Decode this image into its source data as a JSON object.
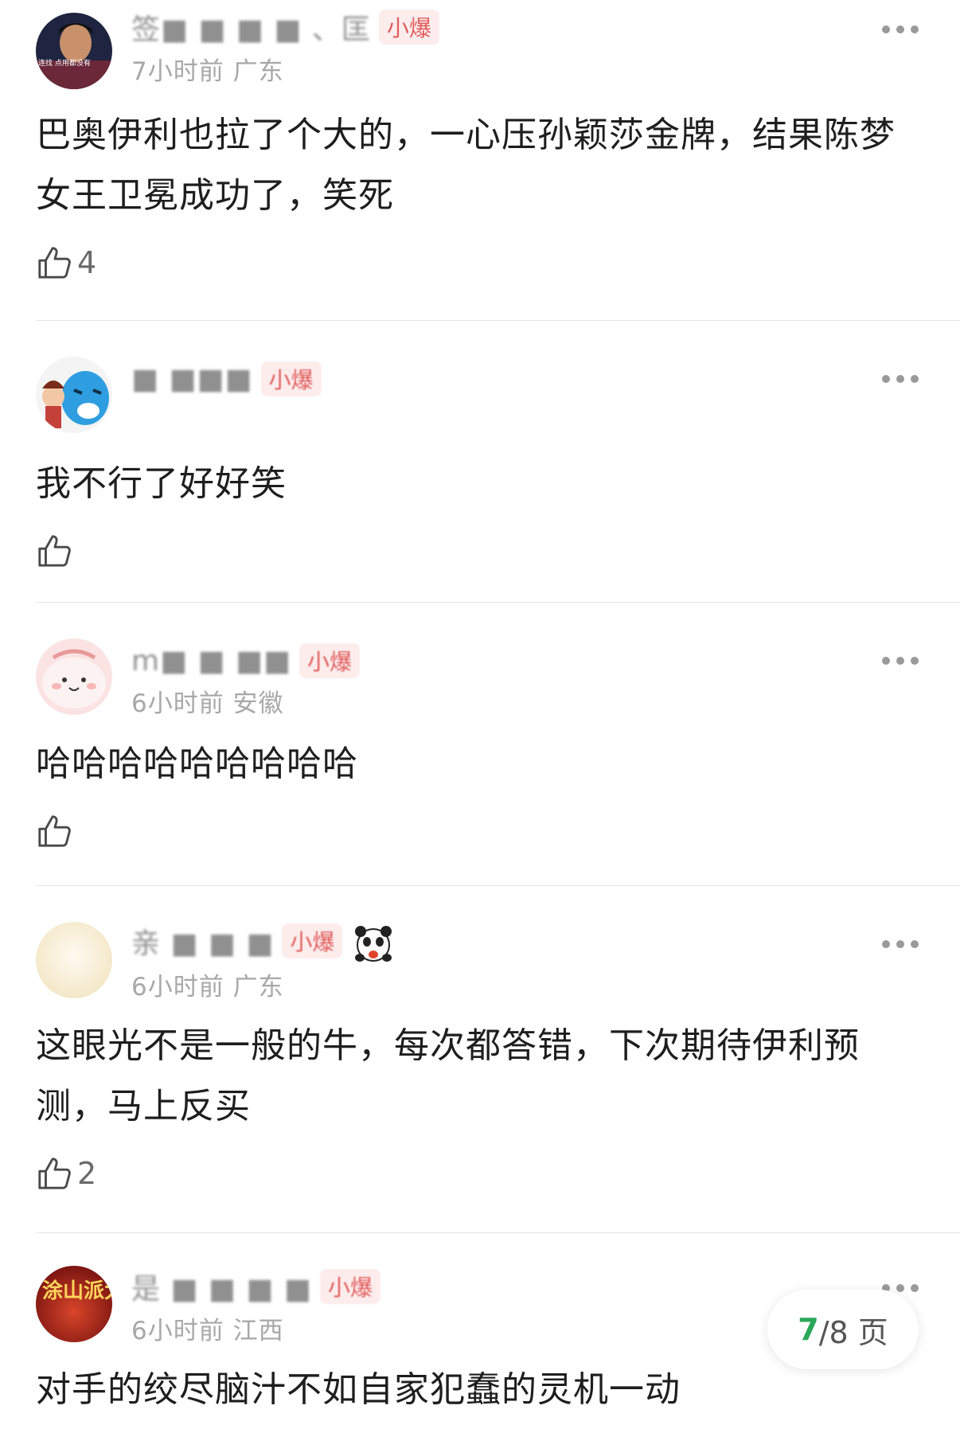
{
  "comments": [
    {
      "user_name": "签■ ■ ■ ■ 、匡",
      "badge": "小爆",
      "time": "7小时前",
      "region": "广东",
      "text": "巴奥伊利也拉了个大的，一心压孙颖莎金牌，结果陈梦女王卫冕成功了，笑死",
      "likes": "4",
      "avatar_text": "连找 点用都没有"
    },
    {
      "user_name": "■ ■■■",
      "badge": "小爆",
      "time": "",
      "region": "",
      "text": "我不行了好好笑",
      "likes": ""
    },
    {
      "user_name": "m■ ■ ■■",
      "badge": "小爆",
      "time": "6小时前",
      "region": "安徽",
      "text": "哈哈哈哈哈哈哈哈哈",
      "likes": ""
    },
    {
      "user_name": "亲 ■ ■ ■",
      "badge": "小爆",
      "time": "6小时前",
      "region": "广东",
      "text": "这眼光不是一般的牛，每次都答错，下次期待伊利预测，马上反买",
      "likes": "2"
    },
    {
      "user_name": "是 ■ ■ ■ ■",
      "badge": "小爆",
      "time": "6小时前",
      "region": "江西",
      "text": "对手的绞尽脑汁不如自家犯蠢的灵机一动",
      "likes": "",
      "avatar_text": "涂山派大星"
    }
  ],
  "pager": {
    "current": "7",
    "total_label": "/8 页"
  },
  "colors": {
    "accent_green": "#2aa85a",
    "badge_red": "#e05c5c",
    "meta_gray": "#a8a8a8"
  }
}
